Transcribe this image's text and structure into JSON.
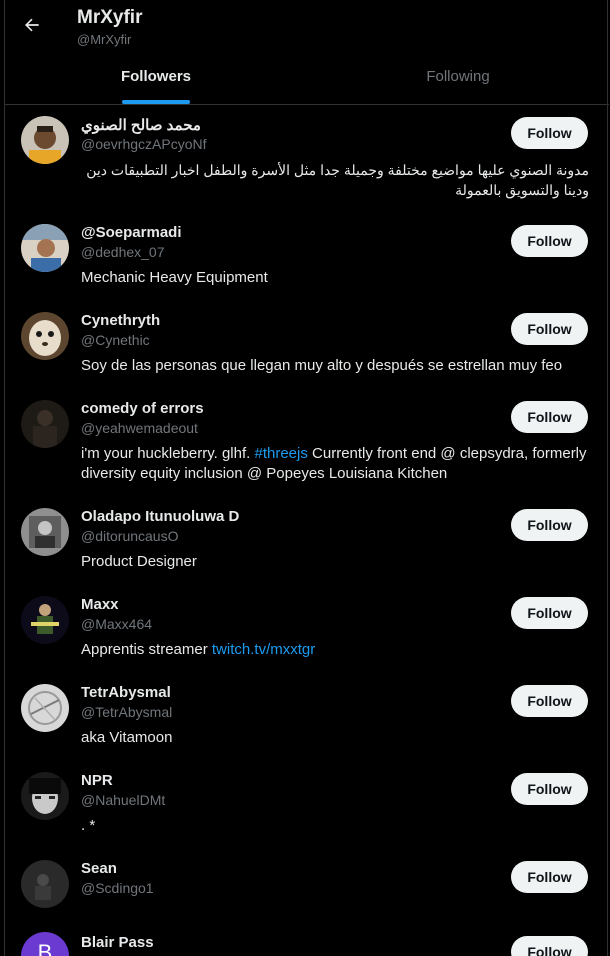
{
  "header": {
    "name": "MrXyfir",
    "handle": "@MrXyfir"
  },
  "tabs": {
    "followers": "Followers",
    "following": "Following"
  },
  "accent_color": "#1d9bf0",
  "users": [
    {
      "name": "محمد صالح الصنوي",
      "handle": "@oevrhgczAPcyoNf",
      "bio": "مدونة الصنوي عليها مواضيع مختلفة وجميلة جدا مثل الأسرة والطفل اخبار التطبيقات دين ودينا والتسويق بالعمولة",
      "follow": "Follow"
    },
    {
      "name": "@Soeparmadi",
      "handle": "@dedhex_07",
      "bio": "Mechanic Heavy Equipment",
      "follow": "Follow"
    },
    {
      "name": "Cynethryth",
      "handle": "@Cynethic",
      "bio": "Soy de las personas que llegan muy alto y después se estrellan muy feo",
      "follow": "Follow"
    },
    {
      "name": "comedy of errors",
      "handle": "@yeahwemadeout",
      "bio_pre": "i'm your huckleberry. glhf. ",
      "bio_tag": "#threejs",
      "bio_post": " Currently front end @ clepsydra, formerly diversity equity inclusion @ Popeyes Louisiana Kitchen",
      "follow": "Follow"
    },
    {
      "name": "Oladapo Itunuoluwa D",
      "handle": "@ditoruncausO",
      "bio": "Product Designer",
      "follow": "Follow"
    },
    {
      "name": "Maxx",
      "handle": "@Maxx464",
      "bio_pre": "Apprentis streamer ",
      "bio_link": "twitch.tv/mxxtgr",
      "follow": "Follow"
    },
    {
      "name": "TetrAbysmal",
      "handle": "@TetrAbysmal",
      "bio": "aka Vitamoon",
      "follow": "Follow"
    },
    {
      "name": "NPR",
      "handle": "@NahuelDMt",
      "bio": ". *",
      "follow": "Follow"
    },
    {
      "name": "Sean",
      "handle": "@Scdingo1",
      "bio": "",
      "follow": "Follow"
    },
    {
      "name": "Blair Pass",
      "avatar_letter": "B",
      "follow": "Follow"
    }
  ]
}
